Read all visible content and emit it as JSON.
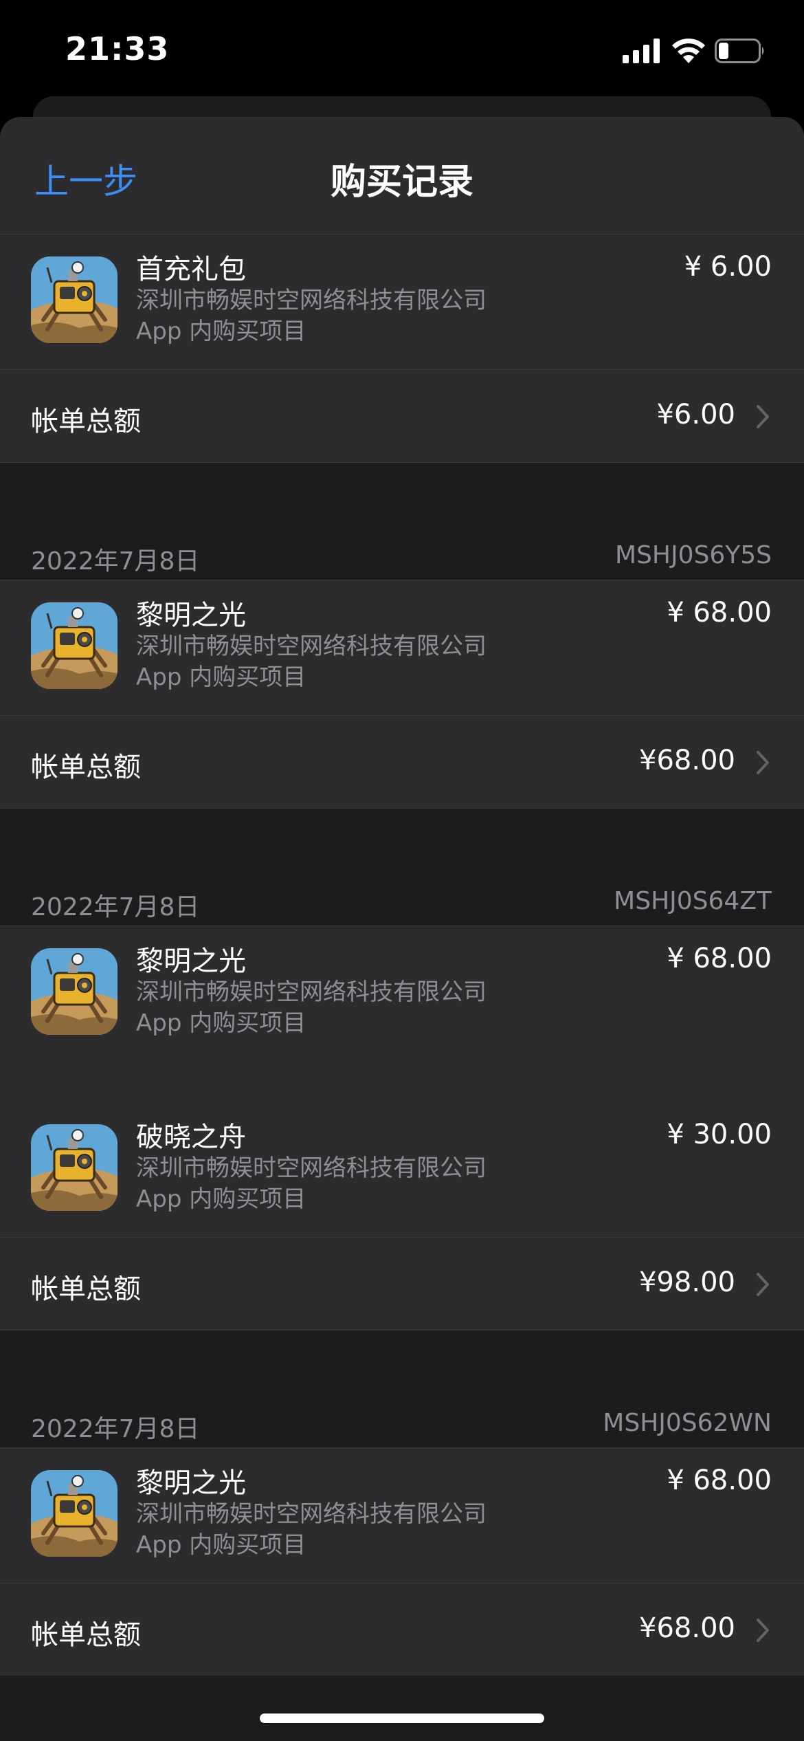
{
  "status_bar": {
    "time": "21:33"
  },
  "nav": {
    "back_label": "上一步",
    "title": "购买记录"
  },
  "orders": [
    {
      "items": [
        {
          "name": "首充礼包",
          "seller": "深圳市畅娱时空网络科技有限公司",
          "type": "App 内购买项目",
          "price": "¥ 6.00",
          "icon": "robot-game-app-icon"
        }
      ],
      "total_label": "帐单总额",
      "total": "¥6.00"
    },
    {
      "date": "2022年7月8日",
      "id": "MSHJ0S6Y5S",
      "items": [
        {
          "name": "黎明之光",
          "seller": "深圳市畅娱时空网络科技有限公司",
          "type": "App 内购买项目",
          "price": "¥ 68.00",
          "icon": "robot-game-app-icon"
        }
      ],
      "total_label": "帐单总额",
      "total": "¥68.00"
    },
    {
      "date": "2022年7月8日",
      "id": "MSHJ0S64ZT",
      "items": [
        {
          "name": "黎明之光",
          "seller": "深圳市畅娱时空网络科技有限公司",
          "type": "App 内购买项目",
          "price": "¥ 68.00",
          "icon": "robot-game-app-icon"
        },
        {
          "name": "破晓之舟",
          "seller": "深圳市畅娱时空网络科技有限公司",
          "type": "App 内购买项目",
          "price": "¥ 30.00",
          "icon": "robot-game-app-icon"
        }
      ],
      "total_label": "帐单总额",
      "total": "¥98.00"
    },
    {
      "date": "2022年7月8日",
      "id": "MSHJ0S62WN",
      "items": [
        {
          "name": "黎明之光",
          "seller": "深圳市畅娱时空网络科技有限公司",
          "type": "App 内购买项目",
          "price": "¥ 68.00",
          "icon": "robot-game-app-icon"
        }
      ],
      "total_label": "帐单总额",
      "total": "¥68.00"
    }
  ],
  "colors": {
    "accent": "#3e8ef7",
    "background": "#1c1c1e",
    "cell": "#2c2c2e",
    "secondary_text": "#8e8e93"
  }
}
